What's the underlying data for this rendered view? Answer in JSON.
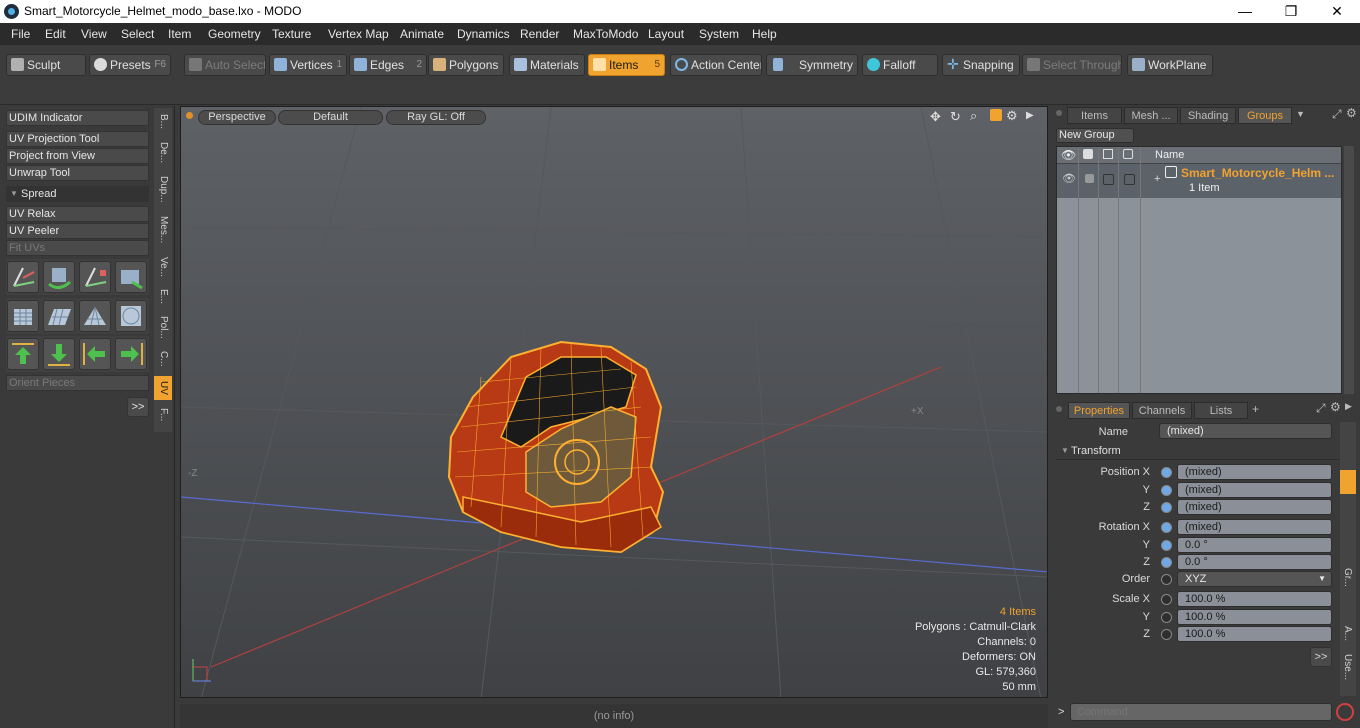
{
  "window": {
    "title": "Smart_Motorcycle_Helmet_modo_base.lxo - MODO",
    "minimize": "—",
    "maximize": "❐",
    "close": "✕"
  },
  "menu": [
    "File",
    "Edit",
    "View",
    "Select",
    "Item",
    "Geometry",
    "Texture",
    "Vertex Map",
    "Animate",
    "Dynamics",
    "Render",
    "MaxToModo",
    "Layout",
    "System",
    "Help"
  ],
  "toolbar": {
    "sculpt": "Sculpt",
    "presets": "Presets",
    "presets_key": "F6",
    "auto_select": "Auto Select",
    "vertices": "Vertices",
    "vertices_num": "1",
    "edges": "Edges",
    "edges_num": "2",
    "polygons": "Polygons",
    "materials": "Materials",
    "items": "Items",
    "items_num": "5",
    "action_center": "Action Center",
    "symmetry": "Symmetry",
    "falloff": "Falloff",
    "snapping": "Snapping",
    "select_through": "Select Through",
    "workplane": "WorkPlane"
  },
  "left_panel": {
    "items": [
      "UDIM Indicator",
      "UV Projection Tool",
      "Project from View",
      "Unwrap Tool"
    ],
    "spread": "Spread",
    "items2": [
      "UV Relax",
      "UV Peeler",
      "Fit UVs"
    ],
    "orient": "Orient Pieces",
    "more": ">>",
    "vtabs": [
      "B...",
      "De...",
      "Dup...",
      "Mes...",
      "Ve...",
      "E...",
      "Pol...",
      "C...",
      "UV",
      "F..."
    ]
  },
  "viewport": {
    "perspective": "Perspective",
    "default": "Default",
    "raygl": "Ray GL: Off",
    "axis_z": "-Z",
    "axis_x": "+X",
    "info": [
      "4 Items",
      "Polygons : Catmull-Clark",
      "Channels: 0",
      "Deformers: ON",
      "GL: 579,360",
      "50 mm"
    ]
  },
  "status": "(no info)",
  "groups_panel": {
    "tabs": [
      "Items",
      "Mesh ...",
      "Shading",
      "Groups"
    ],
    "new_group": "New Group",
    "name_header": "Name",
    "group_name": "Smart_Motorcycle_Helm ...",
    "group_count": "1 Item"
  },
  "properties": {
    "tabs": [
      "Properties",
      "Channels",
      "Lists"
    ],
    "add_tab": "+",
    "name_label": "Name",
    "name_value": "(mixed)",
    "transform": "Transform",
    "rows": [
      {
        "label": "Position X",
        "value": "(mixed)",
        "dot": "blue"
      },
      {
        "label": "Y",
        "value": "(mixed)",
        "dot": "blue"
      },
      {
        "label": "Z",
        "value": "(mixed)",
        "dot": "blue"
      },
      {
        "label": "Rotation X",
        "value": "(mixed)",
        "dot": "blue"
      },
      {
        "label": "Y",
        "value": "0.0 °",
        "dot": "blue"
      },
      {
        "label": "Z",
        "value": "0.0 °",
        "dot": "blue"
      },
      {
        "label": "Order",
        "value": "XYZ",
        "dot": "plain"
      },
      {
        "label": "Scale X",
        "value": "100.0 %",
        "dot": "plain"
      },
      {
        "label": "Y",
        "value": "100.0 %",
        "dot": "plain"
      },
      {
        "label": "Z",
        "value": "100.0 %",
        "dot": "plain"
      }
    ],
    "more": ">>",
    "side_tabs": [
      "Gr...",
      "A...",
      "Use..."
    ]
  },
  "command": {
    "prompt": ">",
    "placeholder": "Command"
  },
  "colors": {
    "accent": "#f0a32e",
    "wire": "#ffb030",
    "helmet": "#b83a14"
  }
}
